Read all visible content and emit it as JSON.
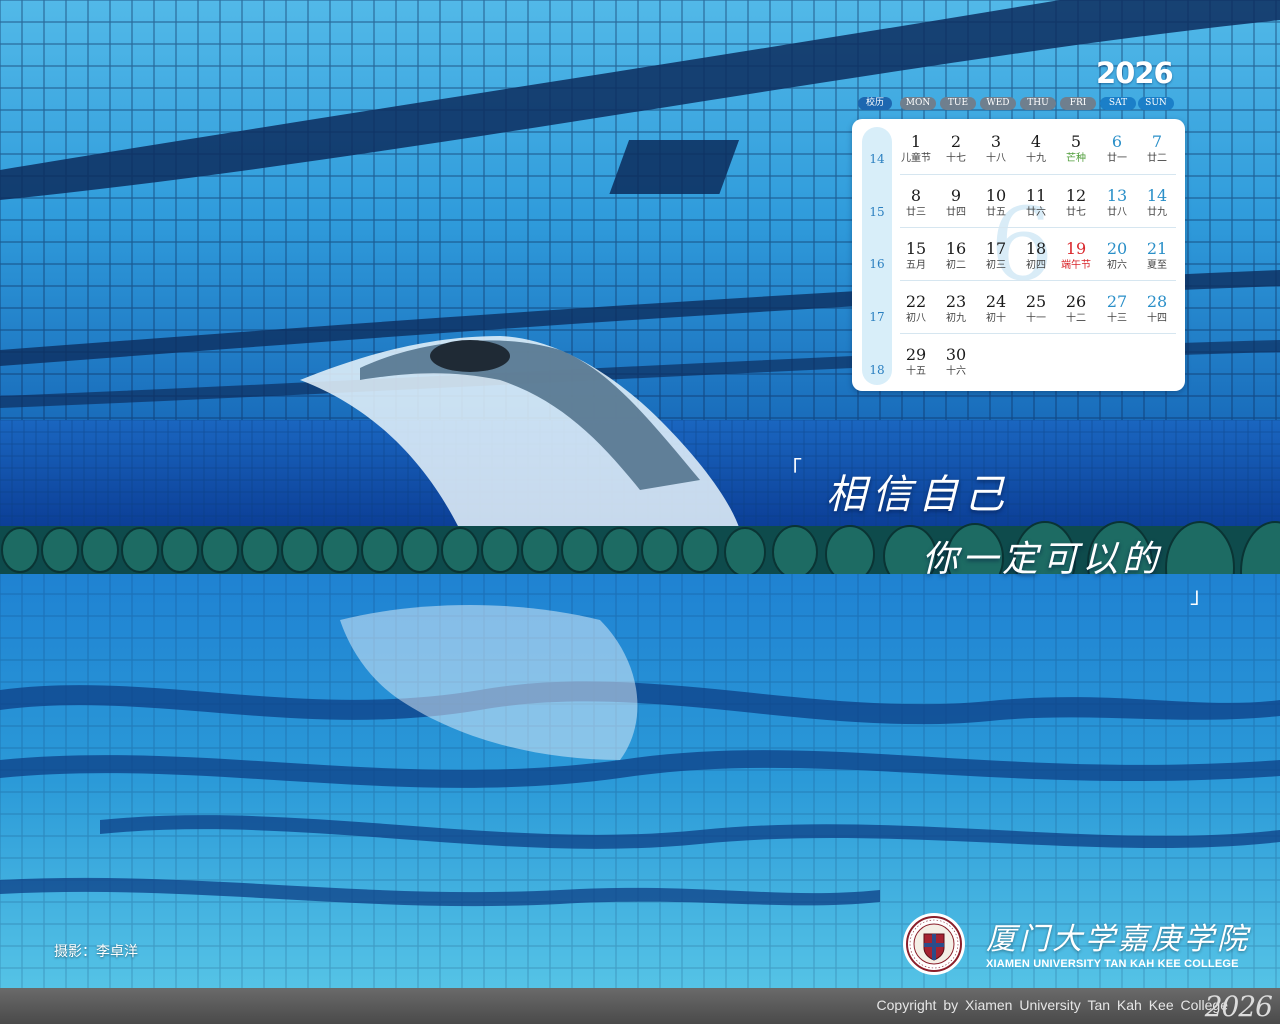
{
  "calendar": {
    "year": "2026",
    "month": "6",
    "headers": [
      "校历",
      "MON",
      "TUE",
      "WED",
      "THU",
      "FRI",
      "SAT",
      "SUN"
    ],
    "weeks": [
      {
        "num": "14",
        "days": [
          {
            "d": "1",
            "l": "儿童节"
          },
          {
            "d": "2",
            "l": "十七"
          },
          {
            "d": "3",
            "l": "十八"
          },
          {
            "d": "4",
            "l": "十九"
          },
          {
            "d": "5",
            "l": "芒种",
            "term": true
          },
          {
            "d": "6",
            "l": "廿一"
          },
          {
            "d": "7",
            "l": "廿二"
          }
        ]
      },
      {
        "num": "15",
        "days": [
          {
            "d": "8",
            "l": "廿三"
          },
          {
            "d": "9",
            "l": "廿四"
          },
          {
            "d": "10",
            "l": "廿五"
          },
          {
            "d": "11",
            "l": "廿六"
          },
          {
            "d": "12",
            "l": "廿七"
          },
          {
            "d": "13",
            "l": "廿八"
          },
          {
            "d": "14",
            "l": "廿九"
          }
        ]
      },
      {
        "num": "16",
        "days": [
          {
            "d": "15",
            "l": "五月"
          },
          {
            "d": "16",
            "l": "初二"
          },
          {
            "d": "17",
            "l": "初三"
          },
          {
            "d": "18",
            "l": "初四"
          },
          {
            "d": "19",
            "l": "端午节",
            "holiday": true
          },
          {
            "d": "20",
            "l": "初六"
          },
          {
            "d": "21",
            "l": "夏至"
          }
        ]
      },
      {
        "num": "17",
        "days": [
          {
            "d": "22",
            "l": "初八"
          },
          {
            "d": "23",
            "l": "初九"
          },
          {
            "d": "24",
            "l": "初十"
          },
          {
            "d": "25",
            "l": "十一"
          },
          {
            "d": "26",
            "l": "十二"
          },
          {
            "d": "27",
            "l": "十三"
          },
          {
            "d": "28",
            "l": "十四"
          }
        ]
      },
      {
        "num": "18",
        "days": [
          {
            "d": "29",
            "l": "十五"
          },
          {
            "d": "30",
            "l": "十六"
          }
        ]
      }
    ]
  },
  "quote": {
    "line1": "相信自己",
    "line2": "你一定可以的",
    "open_bracket": "「",
    "close_bracket": "」"
  },
  "photo_credit": "摄影：李卓洋",
  "college": {
    "name_cn": "厦门大学嘉庚学院",
    "name_en": "XIAMEN UNIVERSITY TAN KAH KEE COLLEGE",
    "seal_icon": "college-seal-icon"
  },
  "footer": {
    "copyright": "Copyright by Xiamen University Tan Kah Kee College",
    "year": "2026"
  },
  "colors": {
    "pool_blue": "#0a6cc0",
    "weekend_blue": "#2a8fc8",
    "holiday_red": "#d9262b",
    "solar_term_green": "#4f9d3a"
  }
}
